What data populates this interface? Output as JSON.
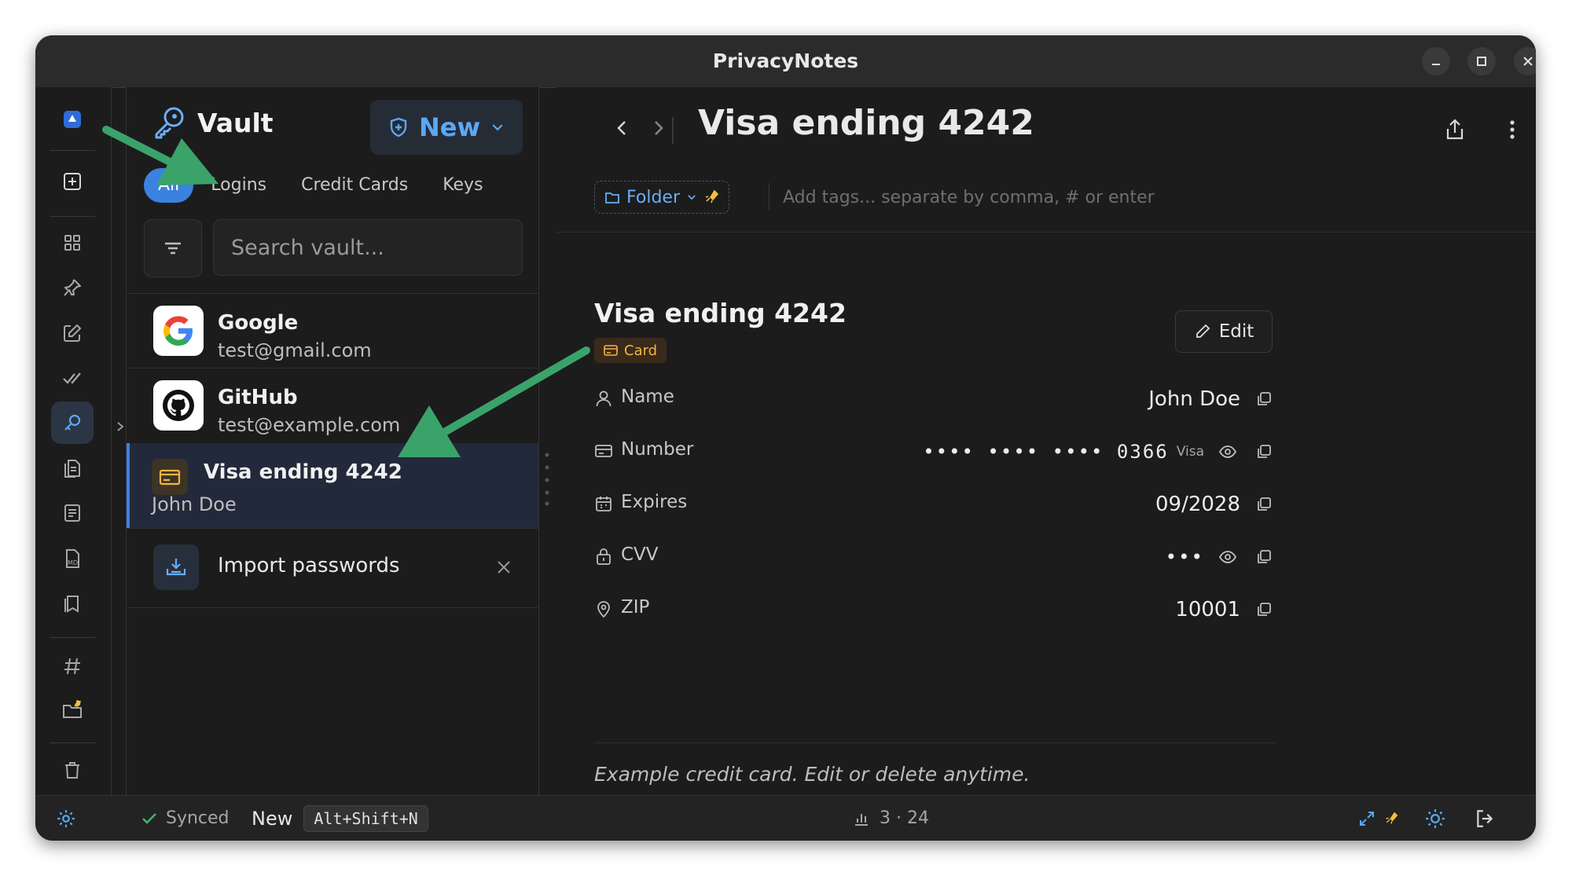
{
  "window": {
    "title": "PrivacyNotes"
  },
  "vault": {
    "title": "Vault",
    "new_button": "New",
    "tabs": [
      "All",
      "Logins",
      "Credit Cards",
      "Keys"
    ],
    "search_placeholder": "Search vault...",
    "items": [
      {
        "name": "Google",
        "sub": "test@gmail.com"
      },
      {
        "name": "GitHub",
        "sub": "test@example.com"
      },
      {
        "name": "Visa ending 4242",
        "sub": "John Doe"
      }
    ],
    "import_label": "Import passwords"
  },
  "detail": {
    "header_title": "Visa ending 4242",
    "folder_label": "Folder",
    "tags_placeholder": "Add tags... separate by comma, # or enter",
    "card_title": "Visa ending 4242",
    "badge": "Card",
    "edit_label": "Edit",
    "fields": {
      "name": {
        "label": "Name",
        "value": "John Doe"
      },
      "number": {
        "label": "Number",
        "value": "•••• •••• •••• 0366",
        "brand": "Visa"
      },
      "expires": {
        "label": "Expires",
        "value": "09/2028"
      },
      "cvv": {
        "label": "CVV",
        "value": "•••"
      },
      "zip": {
        "label": "ZIP",
        "value": "10001"
      }
    },
    "notes": "Example credit card. Edit or delete anytime."
  },
  "statusbar": {
    "synced": "Synced",
    "new_label": "New",
    "shortcut": "Alt+Shift+N",
    "stats": "3 · 24"
  },
  "colors": {
    "accent": "#3b82e0",
    "link": "#5ba8f5",
    "card_badge": "#f1b545",
    "annotation_arrow": "#3aa36a",
    "window_bg": "#1c1c1c"
  }
}
